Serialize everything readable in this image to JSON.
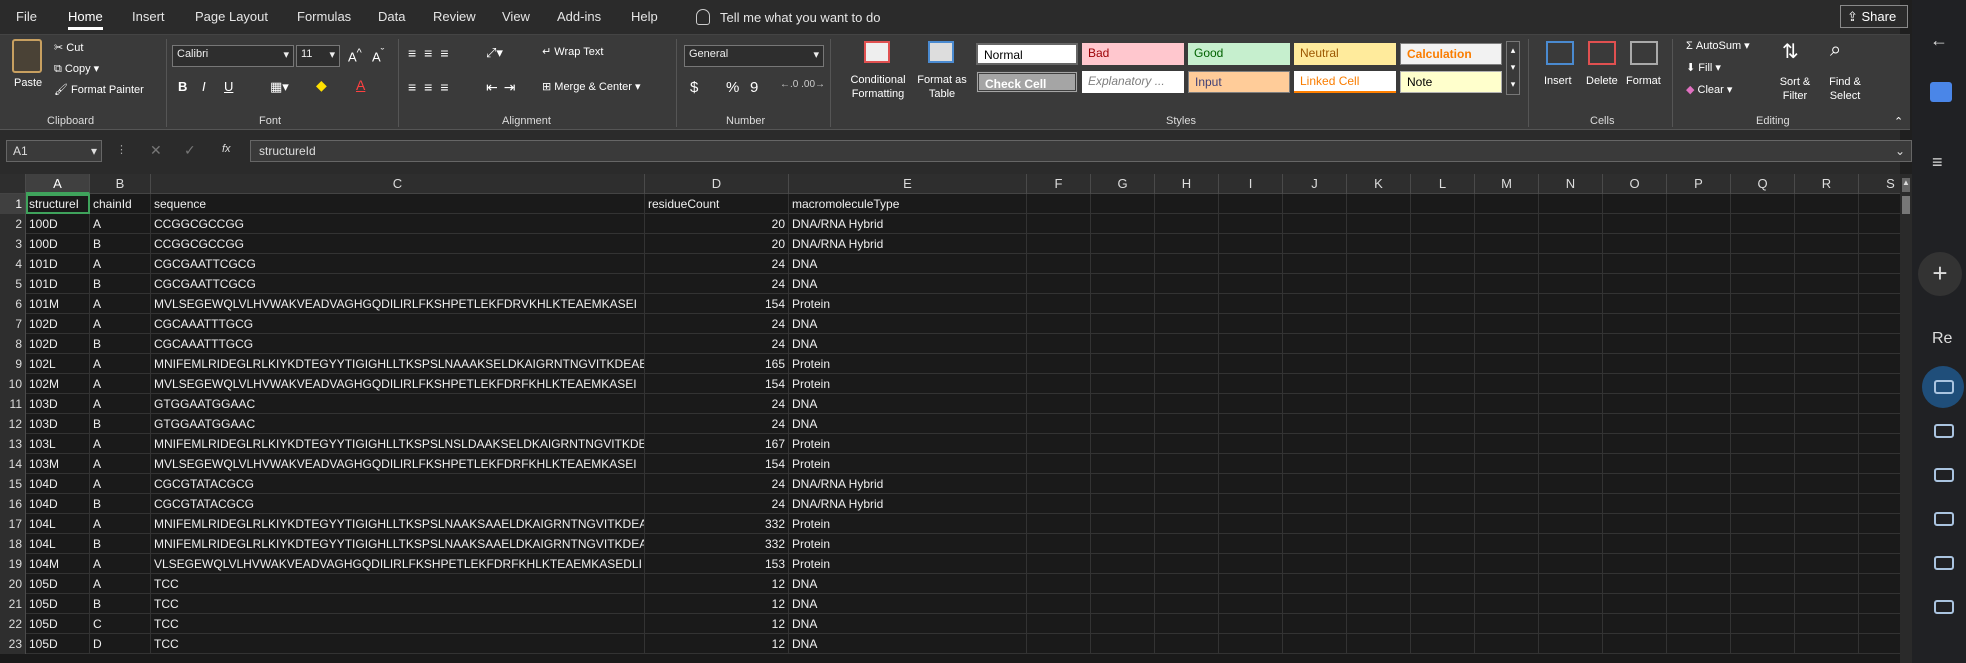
{
  "menu": {
    "tabs": [
      "File",
      "Home",
      "Insert",
      "Page Layout",
      "Formulas",
      "Data",
      "Review",
      "View",
      "Add-ins",
      "Help"
    ],
    "active": "Home",
    "tell_me": "Tell me what you want to do",
    "share": "Share"
  },
  "ribbon": {
    "clipboard": {
      "paste": "Paste",
      "cut": "Cut",
      "copy": "Copy",
      "format_painter": "Format Painter",
      "label": "Clipboard"
    },
    "font": {
      "name": "Calibri",
      "size": "11",
      "bold": "B",
      "italic": "I",
      "underline": "U",
      "label": "Font"
    },
    "alignment": {
      "wrap": "Wrap Text",
      "merge": "Merge & Center",
      "label": "Alignment"
    },
    "number": {
      "format": "General",
      "currency": "$",
      "percent": "%",
      "comma": "9",
      "label": "Number"
    },
    "styles": {
      "conditional": "Conditional Formatting",
      "format_table": "Format as Table",
      "normal": "Normal",
      "bad": "Bad",
      "good": "Good",
      "neutral": "Neutral",
      "calculation": "Calculation",
      "check_cell": "Check Cell",
      "explanatory": "Explanatory ...",
      "input": "Input",
      "linked_cell": "Linked Cell",
      "note": "Note",
      "label": "Styles"
    },
    "cells": {
      "insert": "Insert",
      "delete": "Delete",
      "format": "Format",
      "label": "Cells"
    },
    "editing": {
      "autosum": "AutoSum",
      "fill": "Fill",
      "clear": "Clear",
      "sort": "Sort & Filter",
      "find": "Find & Select",
      "label": "Editing"
    }
  },
  "formula_bar": {
    "name_box": "A1",
    "fx": "fx",
    "value": "structureId"
  },
  "columns": [
    "A",
    "B",
    "C",
    "D",
    "E",
    "F",
    "G",
    "H",
    "I",
    "J",
    "K",
    "L",
    "M",
    "N",
    "O",
    "P",
    "Q",
    "R",
    "S"
  ],
  "rows": [
    {
      "n": "1",
      "a": "structureI",
      "b": "chainId",
      "c": "sequence",
      "d": "residueCount",
      "e": "macromoleculeType",
      "header": true
    },
    {
      "n": "2",
      "a": "100D",
      "b": "A",
      "c": "CCGGCGCCGG",
      "d": "20",
      "e": "DNA/RNA Hybrid"
    },
    {
      "n": "3",
      "a": "100D",
      "b": "B",
      "c": "CCGGCGCCGG",
      "d": "20",
      "e": "DNA/RNA Hybrid"
    },
    {
      "n": "4",
      "a": "101D",
      "b": "A",
      "c": "CGCGAATTCGCG",
      "d": "24",
      "e": "DNA"
    },
    {
      "n": "5",
      "a": "101D",
      "b": "B",
      "c": "CGCGAATTCGCG",
      "d": "24",
      "e": "DNA"
    },
    {
      "n": "6",
      "a": "101M",
      "b": "A",
      "c": "MVLSEGEWQLVLHVWAKVEADVAGHGQDILIRLFKSHPETLEKFDRVKHLKTEAEMKASEI",
      "d": "154",
      "e": "Protein"
    },
    {
      "n": "7",
      "a": "102D",
      "b": "A",
      "c": "CGCAAATTTGCG",
      "d": "24",
      "e": "DNA"
    },
    {
      "n": "8",
      "a": "102D",
      "b": "B",
      "c": "CGCAAATTTGCG",
      "d": "24",
      "e": "DNA"
    },
    {
      "n": "9",
      "a": "102L",
      "b": "A",
      "c": "MNIFEMLRIDEGLRLKIYKDTEGYYTIGIGHLLTKSPSLNAAAKSELDKAIGRNTNGVITKDEAE",
      "d": "165",
      "e": "Protein"
    },
    {
      "n": "10",
      "a": "102M",
      "b": "A",
      "c": "MVLSEGEWQLVLHVWAKVEADVAGHGQDILIRLFKSHPETLEKFDRFKHLKTEAEMKASEI",
      "d": "154",
      "e": "Protein"
    },
    {
      "n": "11",
      "a": "103D",
      "b": "A",
      "c": "GTGGAATGGAAC",
      "d": "24",
      "e": "DNA"
    },
    {
      "n": "12",
      "a": "103D",
      "b": "B",
      "c": "GTGGAATGGAAC",
      "d": "24",
      "e": "DNA"
    },
    {
      "n": "13",
      "a": "103L",
      "b": "A",
      "c": "MNIFEMLRIDEGLRLKIYKDTEGYYTIGIGHLLTKSPSLNSLDAAKSELDKAIGRNTNGVITKDE",
      "d": "167",
      "e": "Protein"
    },
    {
      "n": "14",
      "a": "103M",
      "b": "A",
      "c": "MVLSEGEWQLVLHVWAKVEADVAGHGQDILIRLFKSHPETLEKFDRFKHLKTEAEMKASEI",
      "d": "154",
      "e": "Protein"
    },
    {
      "n": "15",
      "a": "104D",
      "b": "A",
      "c": "CGCGTATACGCG",
      "d": "24",
      "e": "DNA/RNA Hybrid"
    },
    {
      "n": "16",
      "a": "104D",
      "b": "B",
      "c": "CGCGTATACGCG",
      "d": "24",
      "e": "DNA/RNA Hybrid"
    },
    {
      "n": "17",
      "a": "104L",
      "b": "A",
      "c": "MNIFEMLRIDEGLRLKIYKDTEGYYTIGIGHLLTKSPSLNAAKSAAELDKAIGRNTNGVITKDEA",
      "d": "332",
      "e": "Protein"
    },
    {
      "n": "18",
      "a": "104L",
      "b": "B",
      "c": "MNIFEMLRIDEGLRLKIYKDTEGYYTIGIGHLLTKSPSLNAAKSAAELDKAIGRNTNGVITKDEA",
      "d": "332",
      "e": "Protein"
    },
    {
      "n": "19",
      "a": "104M",
      "b": "A",
      "c": "VLSEGEWQLVLHVWAKVEADVAGHGQDILIRLFKSHPETLEKFDRFKHLKTEAEMKASEDLI",
      "d": "153",
      "e": "Protein"
    },
    {
      "n": "20",
      "a": "105D",
      "b": "A",
      "c": "TCC",
      "d": "12",
      "e": "DNA"
    },
    {
      "n": "21",
      "a": "105D",
      "b": "B",
      "c": "TCC",
      "d": "12",
      "e": "DNA"
    },
    {
      "n": "22",
      "a": "105D",
      "b": "C",
      "c": "TCC",
      "d": "12",
      "e": "DNA"
    },
    {
      "n": "23",
      "a": "105D",
      "b": "D",
      "c": "TCC",
      "d": "12",
      "e": "DNA"
    }
  ],
  "side": {
    "re": "Re"
  }
}
